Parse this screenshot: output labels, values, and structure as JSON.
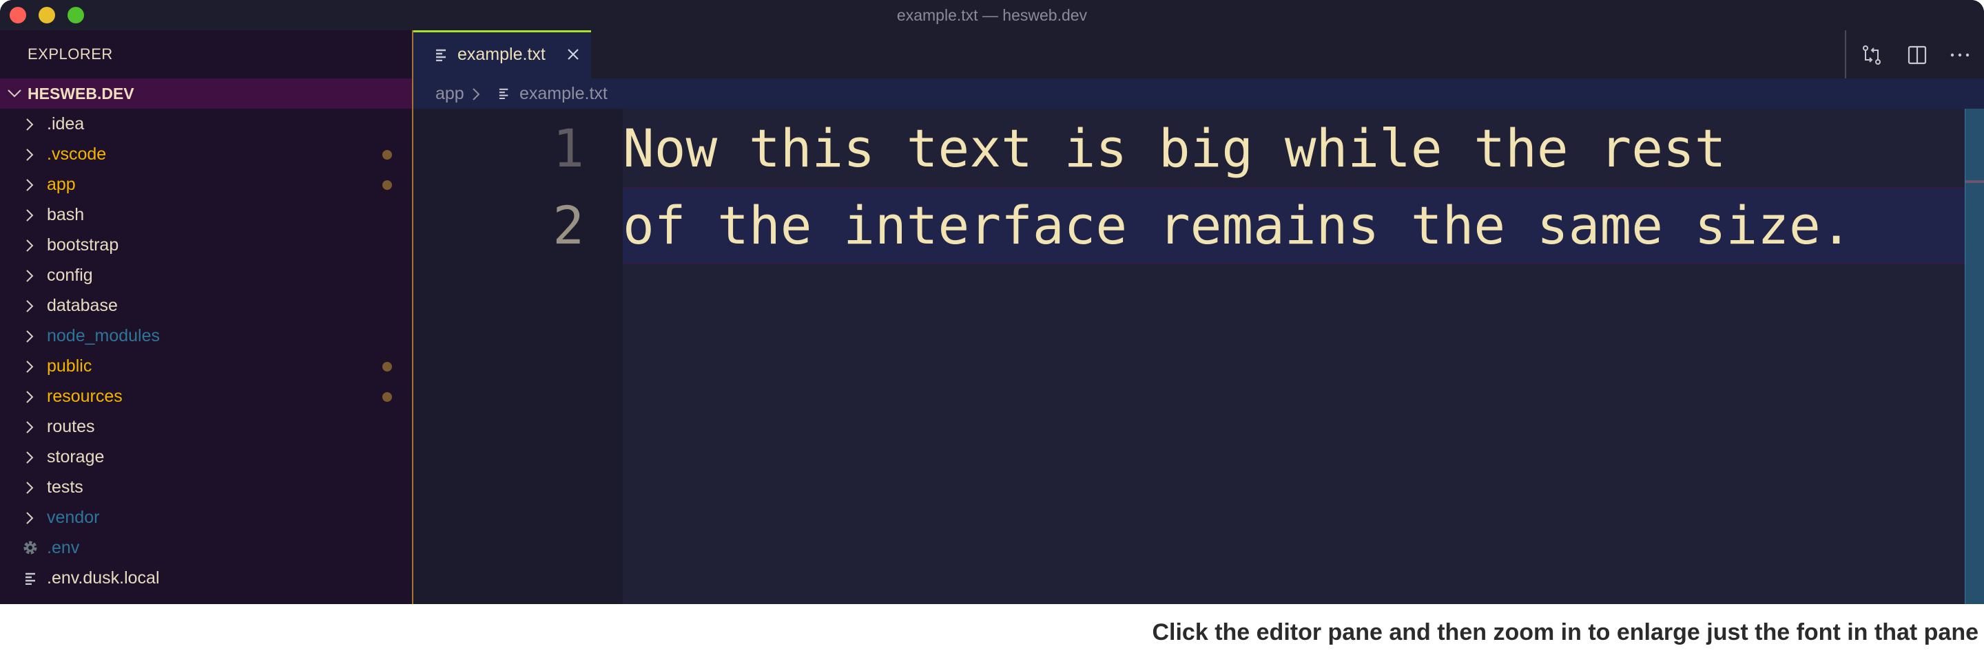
{
  "window": {
    "title": "example.txt — hesweb.dev"
  },
  "traffic_lights": {
    "close": "#fe5f57",
    "minimize": "#e9bf2c",
    "maximize": "#4fc22e"
  },
  "sidebar": {
    "header": "EXPLORER",
    "root": "HESWEB.DEV",
    "items": [
      {
        "label": ".idea",
        "type": "folder",
        "color": "#e8dcc0",
        "modified": false
      },
      {
        "label": ".vscode",
        "type": "folder",
        "color": "#f5b400",
        "modified": true
      },
      {
        "label": "app",
        "type": "folder",
        "color": "#f5b400",
        "modified": true
      },
      {
        "label": "bash",
        "type": "folder",
        "color": "#e8dcc0",
        "modified": false
      },
      {
        "label": "bootstrap",
        "type": "folder",
        "color": "#e8dcc0",
        "modified": false
      },
      {
        "label": "config",
        "type": "folder",
        "color": "#e8dcc0",
        "modified": false
      },
      {
        "label": "database",
        "type": "folder",
        "color": "#e8dcc0",
        "modified": false
      },
      {
        "label": "node_modules",
        "type": "folder",
        "color": "#2e7699",
        "modified": false
      },
      {
        "label": "public",
        "type": "folder",
        "color": "#f5b400",
        "modified": true
      },
      {
        "label": "resources",
        "type": "folder",
        "color": "#f5b400",
        "modified": true
      },
      {
        "label": "routes",
        "type": "folder",
        "color": "#e8dcc0",
        "modified": false
      },
      {
        "label": "storage",
        "type": "folder",
        "color": "#e8dcc0",
        "modified": false
      },
      {
        "label": "tests",
        "type": "folder",
        "color": "#e8dcc0",
        "modified": false
      },
      {
        "label": "vendor",
        "type": "folder",
        "color": "#2e7699",
        "modified": false
      },
      {
        "label": ".env",
        "type": "gear-file",
        "color": "#2e7699",
        "modified": false
      },
      {
        "label": ".env.dusk.local",
        "type": "text-file",
        "color": "#e8dcc0",
        "modified": false
      }
    ]
  },
  "tabs": [
    {
      "label": "example.txt",
      "active": true
    }
  ],
  "toolbar": {
    "icons": [
      "compare-changes-icon",
      "split-editor-icon",
      "more-actions-icon"
    ]
  },
  "breadcrumb": {
    "folder": "app",
    "file": "example.txt"
  },
  "editor": {
    "lines": [
      {
        "number": "1",
        "text": "Now this text is big while the rest"
      },
      {
        "number": "2",
        "text": "of the interface remains the same size."
      }
    ],
    "current_line": 2
  },
  "caption": "Click the editor pane and then zoom in to enlarge just the font in that pane",
  "colors": {
    "accent_tab": "#a6e22e",
    "text": "#f2e3b3",
    "modified": "#f5b400",
    "ignored": "#2e7699"
  }
}
